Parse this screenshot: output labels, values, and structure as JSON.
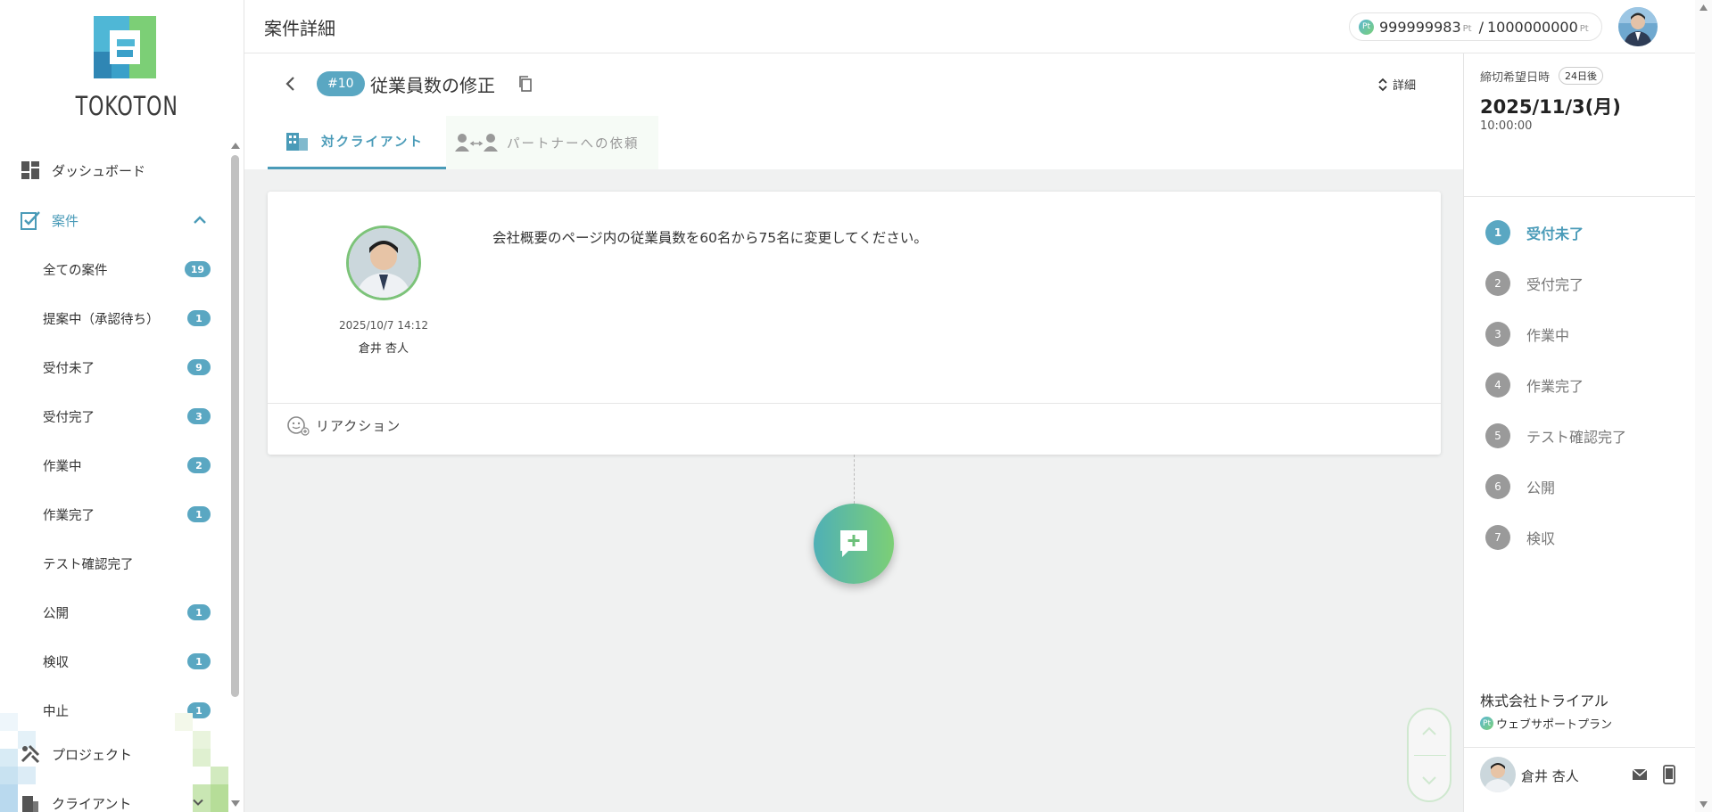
{
  "brand": {
    "logo_text": "TOKOTON"
  },
  "sidebar": {
    "dashboard": "ダッシュボード",
    "cases": "案件",
    "sub_items": [
      {
        "label": "全ての案件",
        "count": "19"
      },
      {
        "label": "提案中（承認待ち）",
        "count": "1"
      },
      {
        "label": "受付未了",
        "count": "9"
      },
      {
        "label": "受付完了",
        "count": "3"
      },
      {
        "label": "作業中",
        "count": "2"
      },
      {
        "label": "作業完了",
        "count": "1"
      },
      {
        "label": "テスト確認完了",
        "count": ""
      },
      {
        "label": "公開",
        "count": "1"
      },
      {
        "label": "検収",
        "count": "1"
      },
      {
        "label": "中止",
        "count": "1"
      }
    ],
    "project": "プロジェクト",
    "client": "クライアント"
  },
  "header": {
    "title": "案件詳細",
    "points_icon": "Pt",
    "points_used": "999999983",
    "points_total": "1000000000",
    "points_unit": "Pt",
    "separator": "/"
  },
  "case": {
    "number": "#10",
    "title": "従業員数の修正",
    "detail_label": "詳細"
  },
  "tabs": [
    {
      "label": "対クライアント",
      "active": true
    },
    {
      "label": "パートナーへの依頼",
      "active": false
    }
  ],
  "message": {
    "datetime": "2025/10/7 14:12",
    "author": "倉井 杏人",
    "text": "会社概要のページ内の従業員数を60名から75名に変更してください。",
    "reaction_label": "リアクション"
  },
  "right_panel": {
    "deadline_label": "締切希望日時",
    "days_left": "24日後",
    "deadline_date": "2025/11/3(月)",
    "deadline_time": "10:00:00",
    "steps": [
      {
        "num": "1",
        "label": "受付未了",
        "active": true
      },
      {
        "num": "2",
        "label": "受付完了",
        "active": false
      },
      {
        "num": "3",
        "label": "作業中",
        "active": false
      },
      {
        "num": "4",
        "label": "作業完了",
        "active": false
      },
      {
        "num": "5",
        "label": "テスト確認完了",
        "active": false
      },
      {
        "num": "6",
        "label": "公開",
        "active": false
      },
      {
        "num": "7",
        "label": "検収",
        "active": false
      }
    ],
    "company": "株式会社トライアル",
    "plan_icon": "Pt",
    "plan": "ウェブサポートプラン",
    "user": "倉井 杏人"
  },
  "colors": {
    "accent": "#4a9bb8",
    "badge": "#5aa7c2",
    "green": "#7cc379"
  }
}
